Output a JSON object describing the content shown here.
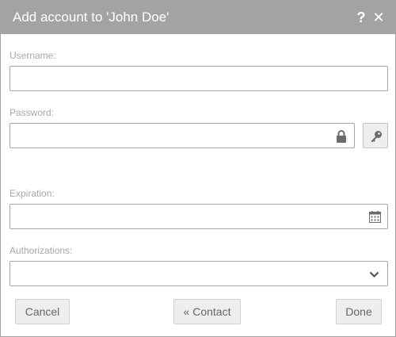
{
  "dialog": {
    "title_prefix": "Add account to '",
    "title_name": "John Doe",
    "title_suffix": "'",
    "help_glyph": "?",
    "close_glyph": "✕"
  },
  "form": {
    "username": {
      "label": "Username:",
      "value": "",
      "placeholder": ""
    },
    "password": {
      "label": "Password:",
      "value": "",
      "placeholder": "",
      "icon": "lock-icon",
      "generate_icon": "key-icon"
    },
    "expiration": {
      "label": "Expiration:",
      "value": "",
      "placeholder": "",
      "icon": "calendar-icon"
    },
    "authorizations": {
      "label": "Authorizations:",
      "selected": "",
      "icon": "chevron-down-icon"
    }
  },
  "buttons": {
    "cancel": "Cancel",
    "contact": "« Contact",
    "done": "Done"
  },
  "colors": {
    "titlebar": "#a3a3a3",
    "label": "#a7a7a7",
    "border": "#a6a6a6",
    "button_bg": "#eeeeee",
    "icon": "#6b6b6b"
  }
}
